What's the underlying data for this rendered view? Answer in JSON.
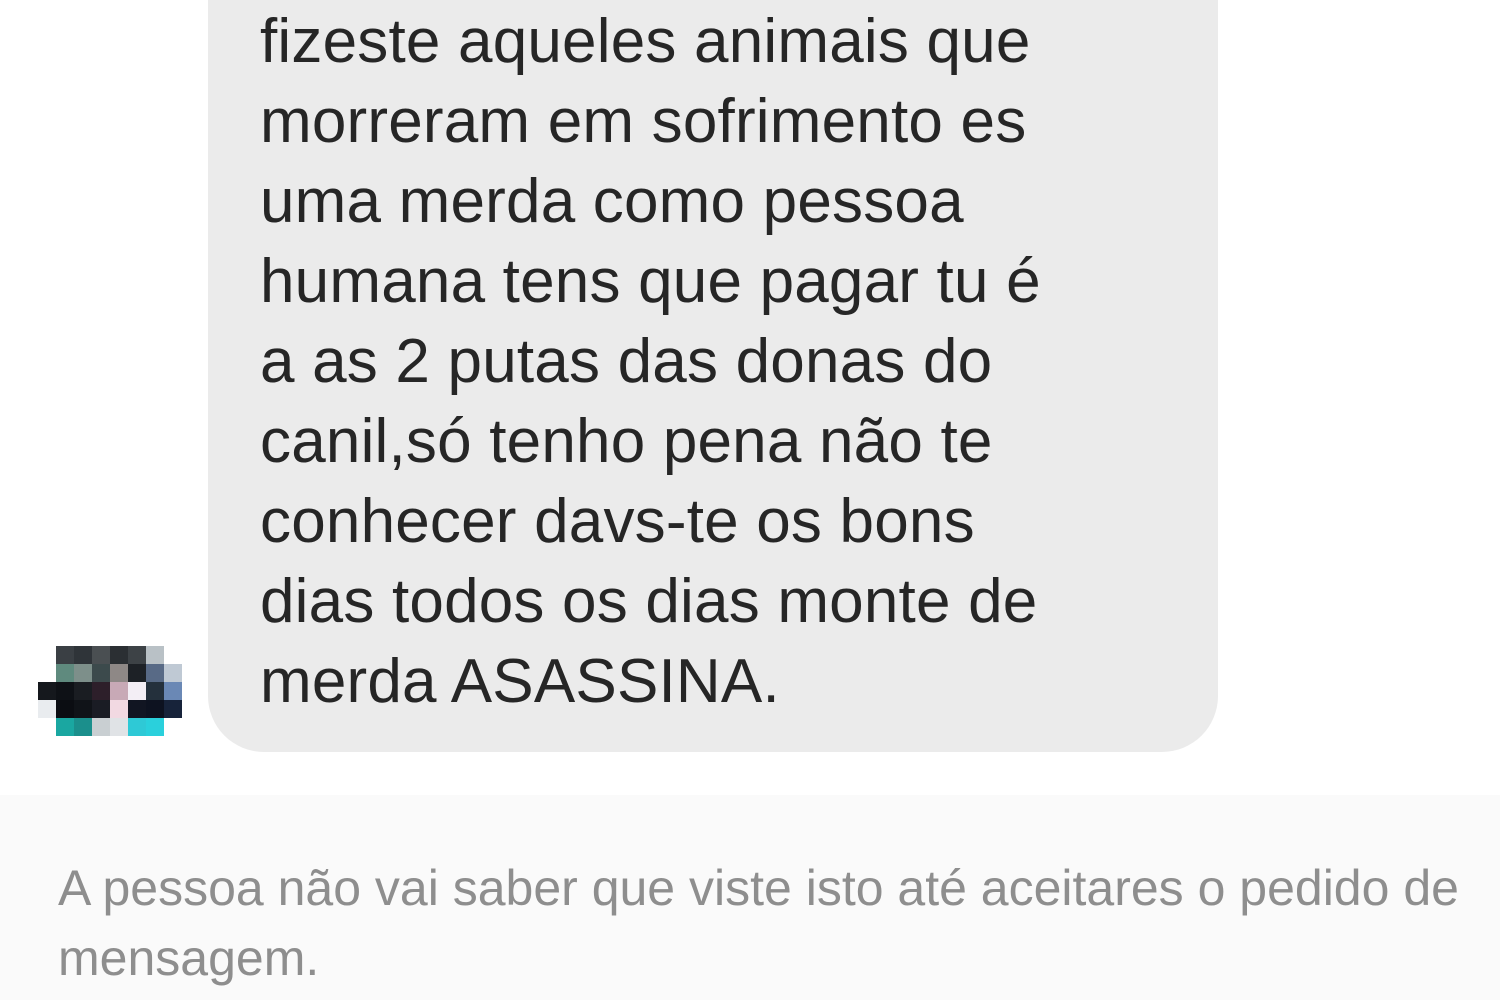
{
  "message": {
    "lines": [
      "fizeste aqueles animais que",
      "morreram em sofrimento es",
      "uma merda como pessoa",
      "humana tens que pagar tu é",
      "a as 2 putas das donas do",
      "canil,só tenho pena não te",
      "conhecer davs-te os bons",
      "dias todos os dias monte de",
      "merda ASASSINA."
    ],
    "bubble_color": "#ebebeb",
    "text_color": "#262626"
  },
  "sender": {
    "avatar_icon": "pixelated-avatar-icon"
  },
  "request_notice": {
    "text": "A pessoa não vai saber que viste isto até aceitares o pedido de mensagem.",
    "text_color": "#8e8e8e",
    "background": "#fafafa"
  }
}
